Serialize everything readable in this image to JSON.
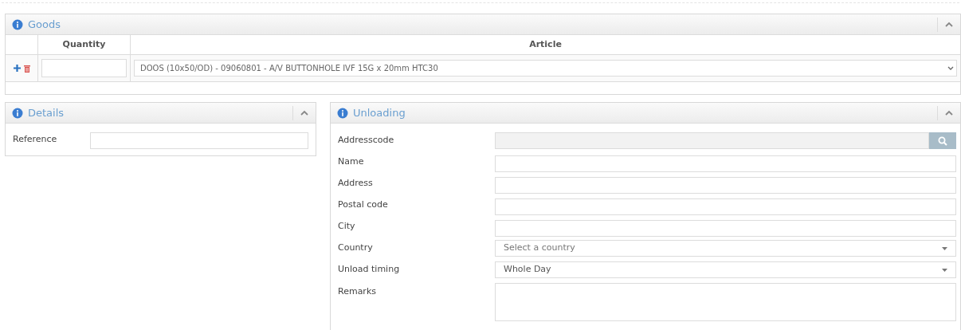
{
  "goods": {
    "title": "Goods",
    "expanded": true,
    "columns": [
      "Quantity",
      "Article"
    ],
    "rows": [
      {
        "article": "DOOS (10x50/OD) - 09060801 - A/V BUTTONHOLE IVF 15G x 20mm HTC30"
      }
    ]
  },
  "details": {
    "title": "Details",
    "expanded": true,
    "fields": [
      {
        "label": "Reference",
        "kind": "text"
      }
    ]
  },
  "unloading": {
    "title": "Unloading",
    "expanded": true,
    "fields": [
      {
        "label": "Addresscode",
        "kind": "lookup"
      },
      {
        "label": "Name",
        "kind": "text"
      },
      {
        "label": "Address",
        "kind": "text"
      },
      {
        "label": "Postal code",
        "kind": "text"
      },
      {
        "label": "City",
        "kind": "text"
      },
      {
        "label": "Country",
        "kind": "select",
        "placeholder": "Select a country"
      },
      {
        "label": "Unload timing",
        "kind": "select",
        "value": "Whole Day"
      },
      {
        "label": "Remarks",
        "kind": "textarea"
      }
    ]
  }
}
